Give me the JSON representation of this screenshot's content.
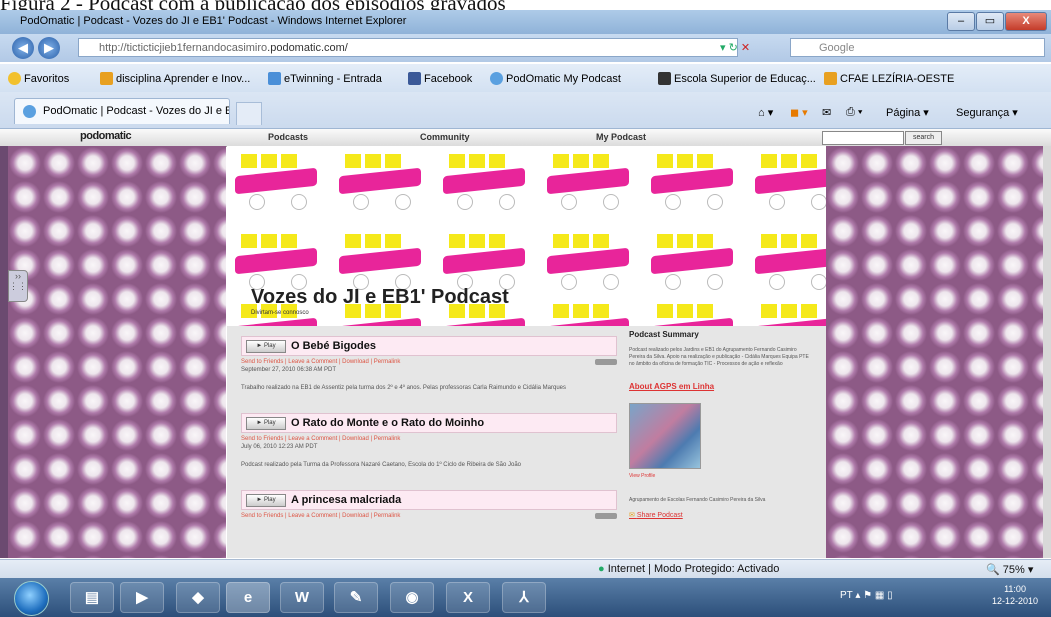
{
  "caption": "Figura 2 - Podcast com a publicação dos episódios gravados",
  "window": {
    "title": "PodOmatic | Podcast - Vozes do JI e EB1' Podcast - Windows Internet Explorer",
    "minimize": "–",
    "restore": "▭",
    "close": "X"
  },
  "address": {
    "url_prefix": "http://tictictic",
    "url_mid": "jieb1fernandocasimiro",
    "url_domain": ".podomatic.com/",
    "search_placeholder": "Google"
  },
  "favorites": {
    "label": "Favoritos",
    "items": [
      "disciplina Aprender e Inov...",
      "eTwinning - Entrada",
      "Facebook",
      "PodOmatic My Podcast",
      "Escola Superior de Educaç...",
      "CFAE LEZÍRIA-OESTE"
    ]
  },
  "tab": {
    "label": "PodOmatic | Podcast - Vozes do JI e E...",
    "pagina": "Página ▾",
    "seguranca": "Segurança ▾"
  },
  "podomatic": {
    "logo": "podomatic",
    "nav": [
      "Podcasts",
      "Community",
      "My Podcast"
    ],
    "search_button": "search"
  },
  "podcast": {
    "title": "Vozes do JI e EB1' Podcast",
    "subtitle": "Divirtam-se connosco",
    "play_label": "► Play",
    "links": "Send to Friends | Leave a Comment | Download | Permalink",
    "episodes": [
      {
        "title": "O Bebé Bigodes",
        "date": "September 27, 2010 06:38 AM PDT",
        "desc": "Trabalho realizado na EB1 de Assentiz pela turma dos 2º e 4º anos. Pelas professoras Carla Raimundo e Cidália Marques"
      },
      {
        "title": "O Rato do Monte e o Rato do Moinho",
        "date": "July 06, 2010 12:23 AM PDT",
        "desc": "Podcast realizado pela Turma da Professora Nazaré Caetano, Escola do 1º Ciclo de Ribeira de São João"
      },
      {
        "title": "A princesa malcriada",
        "date": "",
        "desc": ""
      }
    ]
  },
  "summary": {
    "heading": "Podcast Summary",
    "text": "Podcast realizado pelos Jardins e EB1 do Agrupamento Fernando Casimiro Pereira da Silva. Apoio na realização e publicação - Cidália Marques Equipa PTE no âmbito da oficina de formação TIC - Processos de ação e reflexão",
    "about": "About AGPS em Linha",
    "view_profile": "View Profile",
    "agrup": "Agrupamento de Escolas Fernando Casimiro Pereira da Silva",
    "share": "Share Podcast"
  },
  "status": {
    "zone": "Internet | Modo Protegido: Activado",
    "zoom": "75%"
  },
  "taskbar": {
    "lang": "PT",
    "time": "11:00",
    "date": "12-12-2010"
  }
}
